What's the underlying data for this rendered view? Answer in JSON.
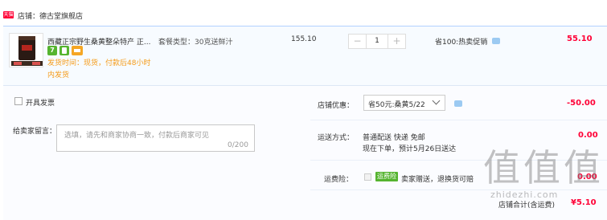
{
  "shop": {
    "badge": "天猫",
    "label": "店铺：德古堂旗舰店"
  },
  "item": {
    "image_icon": "product-thumbnail",
    "title": "西藏正宗野生桑黄整朵特产 正...",
    "service_icons": [
      "seven-day-return-icon",
      "guarantee-icon",
      "card-icon"
    ],
    "service_badge_text": "7",
    "ship_note": "发货时间：现货，付款后48小时内发货",
    "sku": "套餐类型：30克送鲜汁",
    "unit_price": "155.10",
    "qty_minus": "−",
    "qty": "1",
    "qty_plus": "+",
    "promo": "省100:热卖促销",
    "total": "55.10"
  },
  "invoice": {
    "label": "开具发票"
  },
  "message": {
    "label": "给卖家留言：",
    "placeholder": "选填，请先和商家协商一致，付款后商家可见",
    "count": "0/200"
  },
  "discount": {
    "label": "店铺优惠：",
    "selected": "省50元:桑黄5/22",
    "amount": "-50.00"
  },
  "shipping": {
    "label": "运送方式：",
    "line1": "普通配送 快递 免邮",
    "line2": "现在下单，预计5月26日送达",
    "amount": "0.00"
  },
  "insurance": {
    "label": "运费险：",
    "badge": "运费险",
    "text": "卖家赠送，退换货可赔",
    "amount": "0.00"
  },
  "summary": {
    "label": "店铺合计(含运费)",
    "amount": "¥5.10"
  },
  "watermark": {
    "glyphs": "值值值",
    "text": "zhidezhi.com"
  },
  "colors": {
    "accent_red": "#ff0036",
    "border_blue": "#b2d1ff",
    "panel_bg": "#fbfcff",
    "ship_note_orange": "#f59b19",
    "service_green": "#55b42f"
  }
}
